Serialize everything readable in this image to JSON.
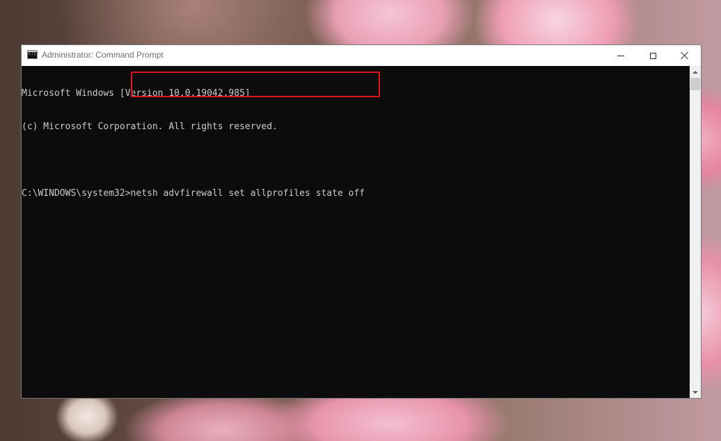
{
  "window": {
    "title": "Administrator: Command Prompt",
    "app_icon_text": "C:\\",
    "controls": {
      "minimize": "minimize",
      "maximize": "maximize",
      "close": "close"
    }
  },
  "console": {
    "lines": [
      "Microsoft Windows [Version 10.0.19042.985]",
      "(c) Microsoft Corporation. All rights reserved.",
      ""
    ],
    "prompt": "C:\\WINDOWS\\system32>",
    "command": "netsh advfirewall set allprofiles state off"
  },
  "colors": {
    "console_bg": "#0c0c0c",
    "console_fg": "#cccccc",
    "highlight": "#e1141e",
    "titlebar_bg": "#ffffff"
  },
  "icons": [
    "cmd-icon",
    "minimize-icon",
    "maximize-icon",
    "close-icon",
    "scroll-up-icon",
    "scroll-down-icon"
  ]
}
